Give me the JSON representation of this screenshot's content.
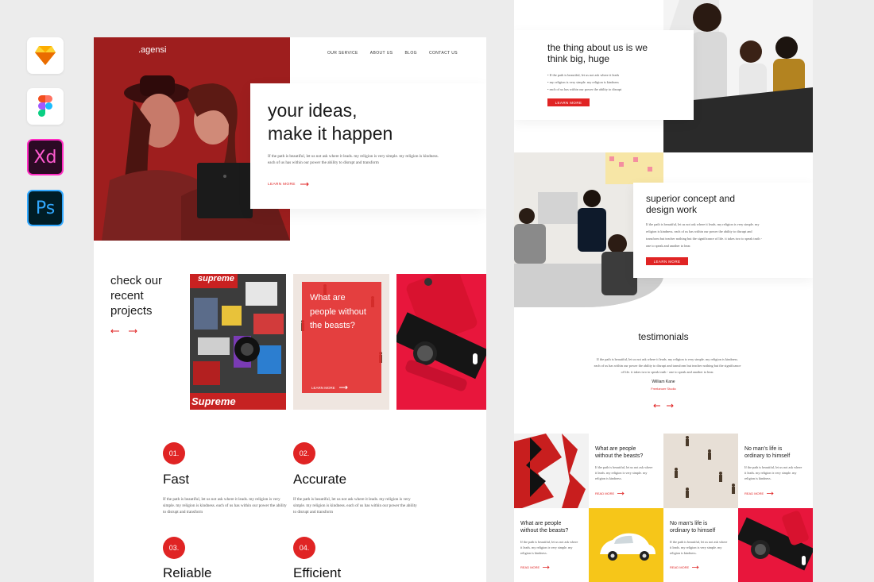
{
  "tools": [
    {
      "name": "sketch-icon"
    },
    {
      "name": "figma-icon"
    },
    {
      "name": "xd-icon",
      "label": "Xd"
    },
    {
      "name": "photoshop-icon",
      "label": "Ps"
    }
  ],
  "left_page": {
    "logo": ".agensi",
    "nav": [
      "OUR SERVICE",
      "ABOUT US",
      "BLOG",
      "CONTACT US"
    ],
    "hero": {
      "title_line1": "your ideas,",
      "title_line2": "make it happen",
      "body": "If the path is beautiful, let us not ask where it leads. my religion is very simple. my religion is kindness. each of us has within our power the ability to disrupt and transform",
      "cta": "LEARN MORE"
    },
    "projects": {
      "heading_line1": "check our",
      "heading_line2": "recent",
      "heading_line3": "projects",
      "card_text": "What are people without the beasts?",
      "card_cta": "LEARN MORE",
      "sticker_text1": "supreme",
      "sticker_text2": "Supreme"
    },
    "features": [
      {
        "num": "01.",
        "title": "Fast",
        "body": "If the path is beautiful, let us not ask where it leads. my religion is very simple. my religion is kindness. each of us has within our power the ability to disrupt and transform"
      },
      {
        "num": "02.",
        "title": "Accurate",
        "body": "If the path is beautiful, let us not ask where it leads. my religion is very simple. my religion is kindness. each of us has within our power the ability to disrupt and transform"
      },
      {
        "num": "03.",
        "title": "Reliable"
      },
      {
        "num": "04.",
        "title": "Efficient"
      }
    ]
  },
  "right_page": {
    "about": {
      "title_line1": "the thing about us is we",
      "title_line2": "think big, huge",
      "bullets": [
        "If the path is beautiful, let us not ask where it leads",
        "my religion is very simple. my religion is kindness",
        "each of us has within our power the ability to disrupt"
      ],
      "cta": "LEARN MORE"
    },
    "concept": {
      "title_line1": "superior concept and",
      "title_line2": "design work",
      "body": "If the path is beautiful, let us not ask where it leads. my religion is very simple. my religion is kindness. each of us has within our power the ability to disrupt and transform but teacher nothing but the significance of life. it takes two to speak truth - one to speak and another to hear.",
      "cta": "LEARN MORE"
    },
    "testimonials": {
      "title": "testimonials",
      "quote": "If the path is beautiful, let us not ask where it leads. my religion is very simple. my religion is kindness. each of us has within our power the ability to disrupt and transform but teacher nothing but the significance of life. it takes two to speak truth - one to speak and another to hear.",
      "name": "William Kane",
      "role": "Freelancer Studio"
    },
    "grid": [
      {
        "title_line1": "What are people",
        "title_line2": "without the beasts?",
        "body": "If the path is beautiful, let us not ask where it leads. my religion is very simple. my religion is kindness.",
        "cta": "READ MORE"
      },
      {
        "title_line1": "No man's life is",
        "title_line2": "ordinary to himself",
        "body": "If the path is beautiful, let us not ask where it leads. my religion is very simple. my religion is kindness.",
        "cta": "READ MORE"
      },
      {
        "title_line1": "What are people",
        "title_line2": "without the beasts?",
        "body": "If the path is beautiful, let us not ask where it leads. my religion is very simple. my religion is kindness.",
        "cta": "READ MORE"
      },
      {
        "title_line1": "No man's life is",
        "title_line2": "ordinary to himself",
        "body": "If the path is beautiful, let us not ask where it leads. my religion is very simple. my religion is kindness.",
        "cta": "READ MORE"
      }
    ]
  }
}
